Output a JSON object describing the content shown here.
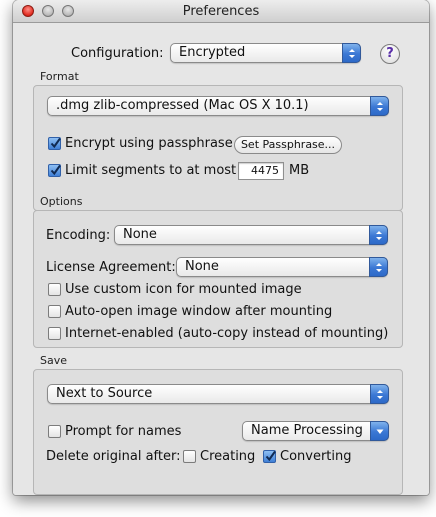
{
  "window": {
    "title": "Preferences"
  },
  "configuration": {
    "label": "Configuration:",
    "value": "Encrypted",
    "help": "?"
  },
  "format": {
    "section": "Format",
    "image_format": ".dmg zlib-compressed (Mac OS X 10.1)",
    "encrypt_label": "Encrypt using passphrase",
    "encrypt_checked": true,
    "set_passphrase_button": "Set Passphrase...",
    "limit_label": "Limit segments to at most",
    "limit_checked": true,
    "limit_value": "4475",
    "limit_unit": "MB"
  },
  "options": {
    "section": "Options",
    "encoding_label": "Encoding:",
    "encoding_value": "None",
    "license_label": "License Agreement:",
    "license_value": "None",
    "custom_icon_label": "Use custom icon for mounted image",
    "custom_icon_checked": false,
    "auto_open_label": "Auto-open image window after mounting",
    "auto_open_checked": false,
    "internet_label": "Internet-enabled (auto-copy instead of mounting)",
    "internet_checked": false
  },
  "save": {
    "section": "Save",
    "location_value": "Next to Source",
    "prompt_label": "Prompt for names",
    "prompt_checked": false,
    "name_processing": "Name Processing",
    "delete_label": "Delete original after:",
    "creating_label": "Creating",
    "creating_checked": false,
    "converting_label": "Converting",
    "converting_checked": true
  }
}
